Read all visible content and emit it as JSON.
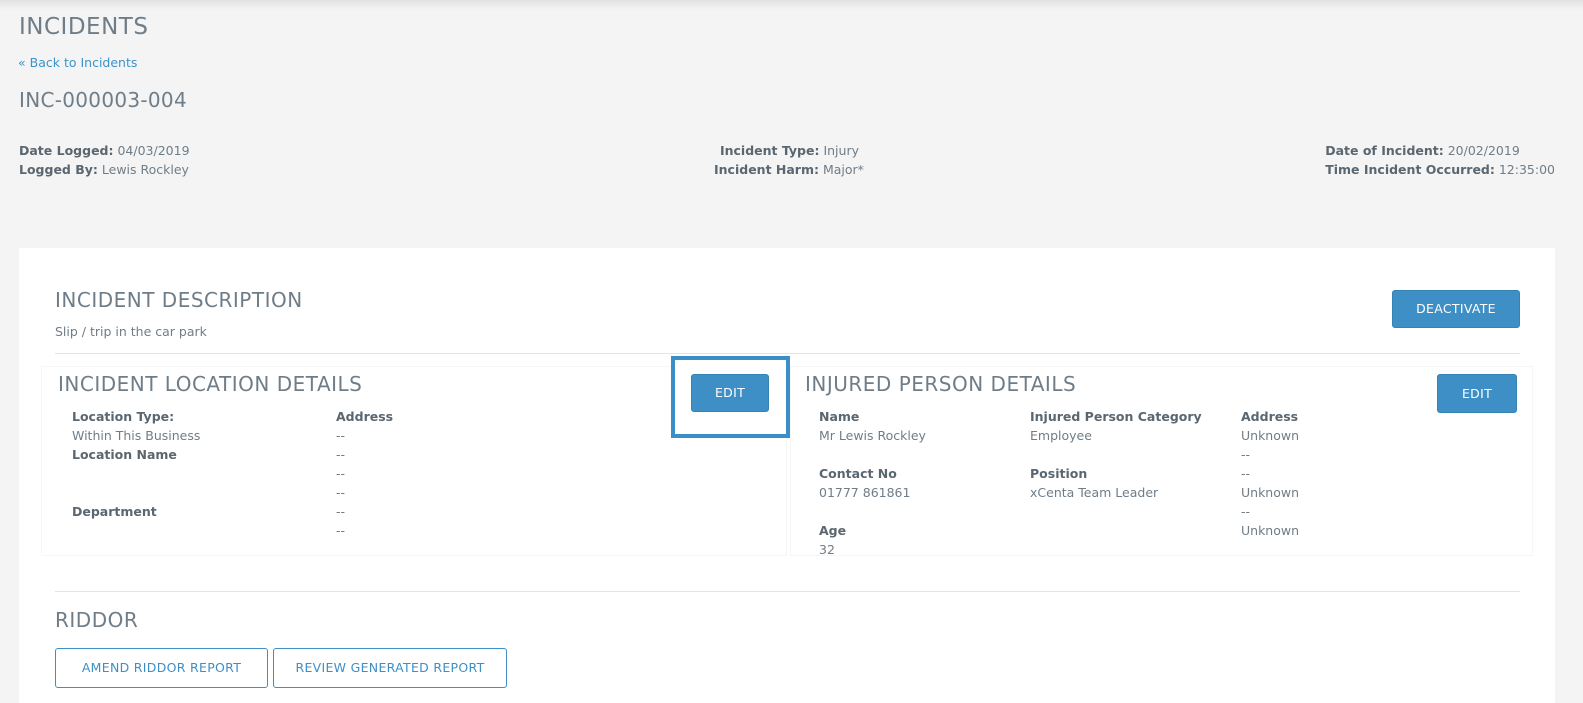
{
  "header": {
    "title": "INCIDENTS",
    "back_link": "« Back to Incidents",
    "incident_id": "INC-000003-004"
  },
  "meta": {
    "date_logged_label": "Date Logged:",
    "date_logged": "04/03/2019",
    "logged_by_label": "Logged By:",
    "logged_by": "Lewis Rockley",
    "incident_type_label": "Incident Type:",
    "incident_type": "Injury",
    "incident_harm_label": "Incident Harm:",
    "incident_harm": "Major*",
    "date_of_incident_label": "Date of Incident:",
    "date_of_incident": "20/02/2019",
    "time_occurred_label": "Time Incident Occurred:",
    "time_occurred": "12:35:00"
  },
  "description": {
    "title": "INCIDENT DESCRIPTION",
    "text": "Slip / trip in the car park",
    "deactivate_label": "DEACTIVATE"
  },
  "location": {
    "title": "INCIDENT LOCATION DETAILS",
    "edit_label": "EDIT",
    "location_type_label": "Location Type:",
    "location_type": "Within This Business",
    "location_name_label": "Location Name",
    "department_label": "Department",
    "address_label": "Address",
    "address_lines": [
      "--",
      "--",
      "--",
      "--",
      "--",
      "--",
      "--"
    ]
  },
  "injured": {
    "title": "INJURED PERSON DETAILS",
    "edit_label": "EDIT",
    "name_label": "Name",
    "name": "Mr Lewis Rockley",
    "contact_label": "Contact No",
    "contact": "01777 861861",
    "age_label": "Age",
    "age": "32",
    "category_label": "Injured Person Category",
    "category": "Employee",
    "position_label": "Position",
    "position": "xCenta Team Leader",
    "address_label": "Address",
    "address_lines": [
      "Unknown",
      "--",
      "--",
      "Unknown",
      "--",
      "Unknown"
    ]
  },
  "riddor": {
    "title": "RIDDOR",
    "amend_label": "AMEND RIDDOR REPORT",
    "review_label": "REVIEW GENERATED REPORT"
  }
}
